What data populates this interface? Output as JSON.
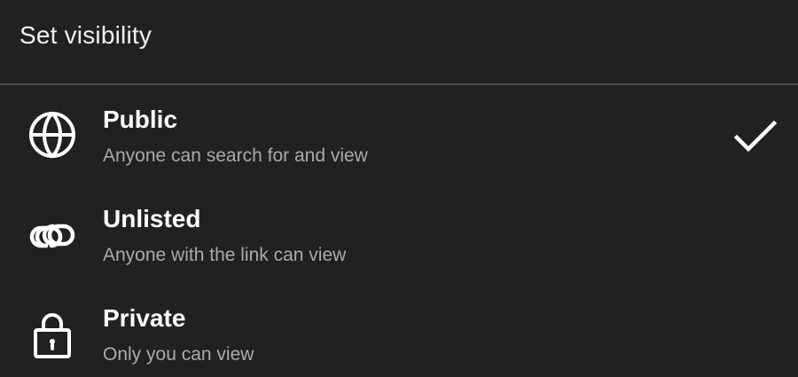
{
  "sheet": {
    "title": "Set visibility"
  },
  "options": [
    {
      "label": "Public",
      "description": "Anyone can search for and view",
      "icon": "globe-icon",
      "selected": true
    },
    {
      "label": "Unlisted",
      "description": "Anyone with the link can view",
      "icon": "link-icon",
      "selected": false
    },
    {
      "label": "Private",
      "description": "Only you can view",
      "icon": "lock-icon",
      "selected": false
    }
  ],
  "colors": {
    "background": "#212121",
    "divider": "#4a4a4a",
    "primary_text": "#ffffff",
    "secondary_text": "#aaaaaa"
  }
}
